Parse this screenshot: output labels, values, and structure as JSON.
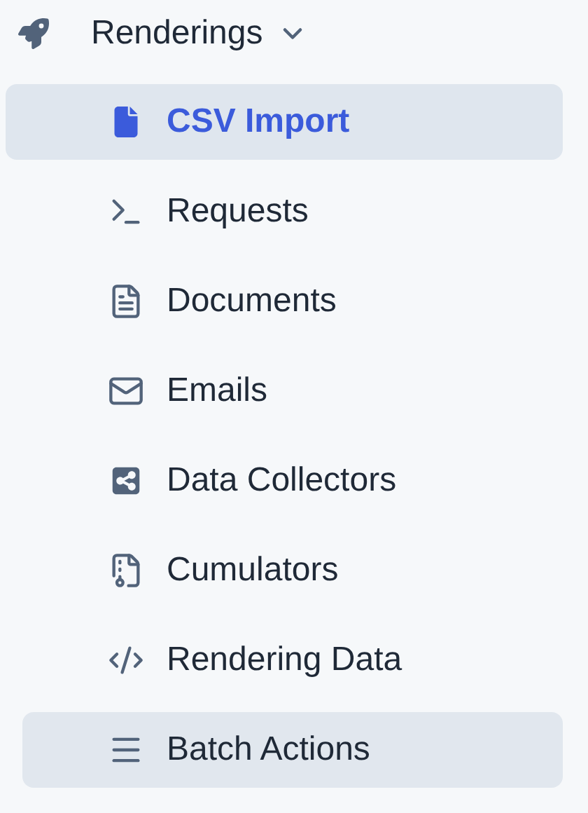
{
  "section": {
    "title": "Renderings",
    "expanded": true
  },
  "items": [
    {
      "label": "CSV Import",
      "selected": true,
      "hovered": false
    },
    {
      "label": "Requests",
      "selected": false,
      "hovered": false
    },
    {
      "label": "Documents",
      "selected": false,
      "hovered": false
    },
    {
      "label": "Emails",
      "selected": false,
      "hovered": false
    },
    {
      "label": "Data Collectors",
      "selected": false,
      "hovered": false
    },
    {
      "label": "Cumulators",
      "selected": false,
      "hovered": false
    },
    {
      "label": "Rendering Data",
      "selected": false,
      "hovered": false
    },
    {
      "label": "Batch Actions",
      "selected": false,
      "hovered": true
    }
  ]
}
